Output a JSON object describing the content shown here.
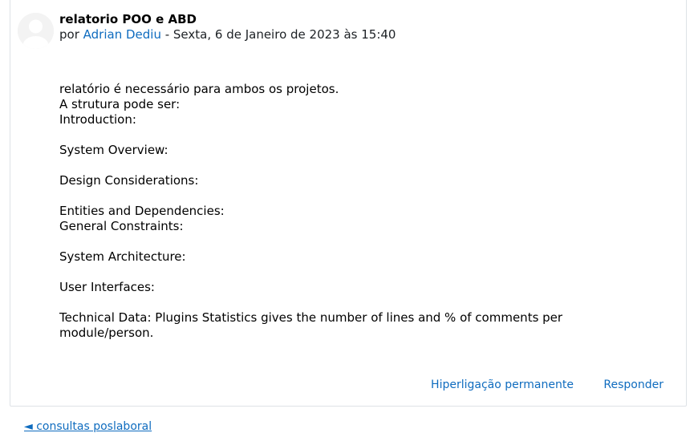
{
  "post": {
    "subject": "relatorio POO e ABD",
    "by_prefix": "por",
    "author": "Adrian Dediu",
    "date_sep": " - ",
    "date": "Sexta, 6 de Janeiro de 2023 às 15:40",
    "body": [
      "relatório é necessário para ambos os projetos.",
      "A strutura pode ser:",
      "Introduction:",
      "",
      "System Overview:",
      "",
      "Design Considerations:",
      "",
      "Entities and Dependencies:",
      "General Constraints:",
      "",
      "System Architecture:",
      "",
      "User Interfaces:",
      "",
      "Technical Data: Plugins Statistics gives the number of lines and % of comments per module/person."
    ],
    "commands": {
      "permalink": "Hiperligação permanente",
      "reply": "Responder"
    }
  },
  "navigation": {
    "prev_link": "◄ consultas poslaboral"
  },
  "colors": {
    "link": "#0f6cbf",
    "border": "#dee2e6",
    "text": "#1d2125"
  }
}
